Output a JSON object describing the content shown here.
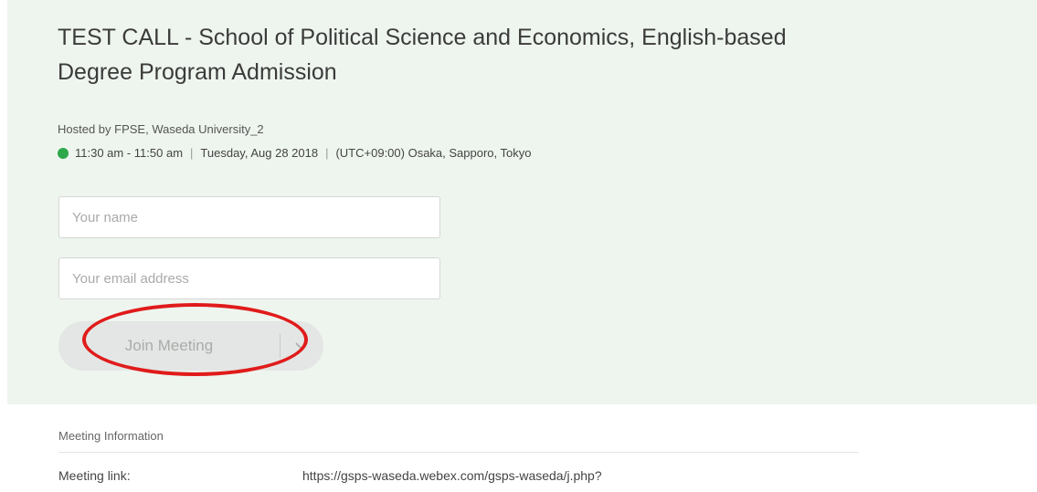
{
  "meeting": {
    "title": "TEST CALL - School of Political Science and Economics, English-based Degree Program Admission",
    "host": "Hosted by FPSE, Waseda University_2",
    "status_color": "#2ea84a",
    "time_range": "11:30 am - 11:50 am",
    "date": "Tuesday, Aug 28 2018",
    "timezone": "(UTC+09:00) Osaka, Sapporo, Tokyo"
  },
  "form": {
    "name_placeholder": "Your name",
    "email_placeholder": "Your email address",
    "join_label": "Join Meeting",
    "dropdown_icon": "chevron-down-icon"
  },
  "annotation": {
    "color": "#e01b1b",
    "target": "join-meeting-button"
  },
  "info": {
    "heading": "Meeting Information",
    "link_label": "Meeting link:",
    "link_value": "https://gsps-waseda.webex.com/gsps-waseda/j.php?"
  }
}
